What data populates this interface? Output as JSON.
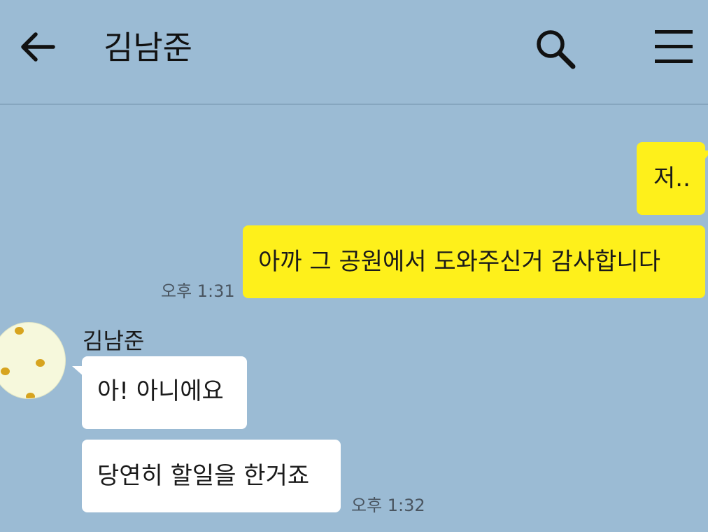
{
  "header": {
    "title": "김남준",
    "icons": {
      "back": "back-arrow-icon",
      "search": "search-icon",
      "menu": "hamburger-menu-icon"
    }
  },
  "colors": {
    "background": "#9bbbd4",
    "my_bubble": "#fef01b",
    "their_bubble": "#ffffff"
  },
  "messages": {
    "mine": [
      {
        "text": "저.."
      },
      {
        "text": "아까 그 공원에서 도와주신거 감사합니다",
        "time": "오후 1:31"
      }
    ],
    "theirs": {
      "sender": "김남준",
      "items": [
        {
          "text": "아! 아니에요"
        },
        {
          "text": "당연히 할일을 한거죠",
          "time": "오후 1:32"
        }
      ]
    }
  }
}
